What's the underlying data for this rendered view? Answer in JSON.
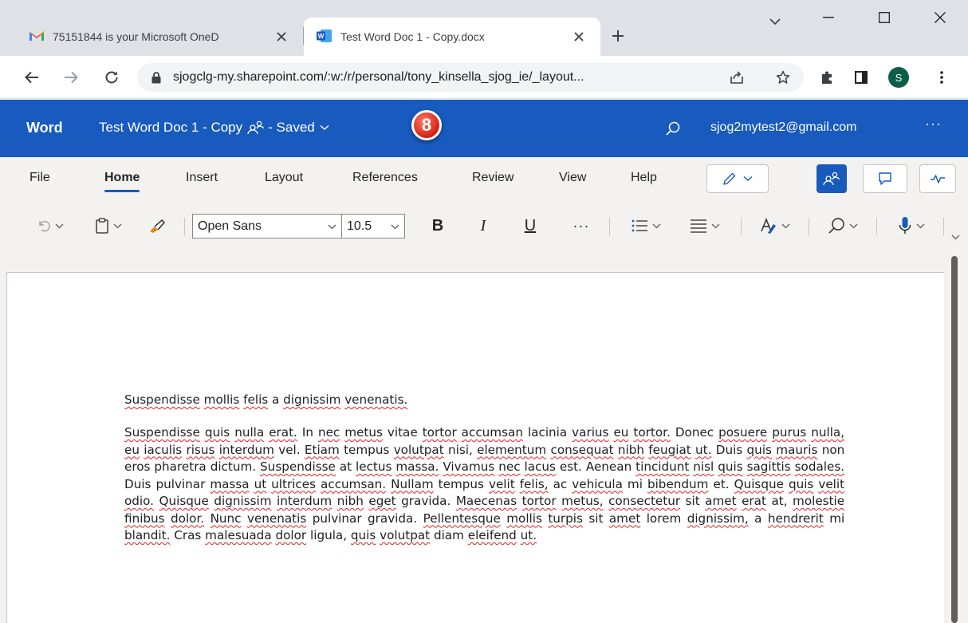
{
  "browser": {
    "tabs": [
      {
        "title": "75151844 is your Microsoft OneD",
        "favicon": "gmail-icon",
        "active": false
      },
      {
        "title": "Test Word Doc 1 - Copy.docx",
        "favicon": "word-icon",
        "active": true
      }
    ],
    "url": "sjogclg-my.sharepoint.com/:w:/r/personal/tony_kinsella_sjog_ie/_layout...",
    "profile_initial": "S",
    "colors": {
      "tabstrip": "#dee1e6",
      "profile": "#0b5e4a"
    }
  },
  "word": {
    "app_name": "Word",
    "doc_title": "Test Word Doc 1 - Copy",
    "save_status": "- Saved",
    "badge_number": "8",
    "account": "sjog2mytest2@gmail.com",
    "more": "···",
    "colors": {
      "header": "#185abd",
      "ribbon": "#f3f2f1",
      "badge": "#d4210f"
    }
  },
  "ribbon": {
    "tabs": [
      "File",
      "Home",
      "Insert",
      "Layout",
      "References",
      "Review",
      "View",
      "Help"
    ],
    "active_tab": "Home",
    "font_name": "Open Sans",
    "font_size": "10.5",
    "bold": "B",
    "italic": "I",
    "underline": "U",
    "more": "···"
  },
  "document": {
    "heading": "Suspendisse mollis felis a dignissim venenatis.",
    "body": "Suspendisse quis nulla erat. In nec metus vitae tortor accumsan lacinia varius eu tortor. Donec posuere purus nulla, eu iaculis risus interdum vel. Etiam tempus volutpat nisi, elementum consequat nibh feugiat ut. Duis quis mauris non eros pharetra dictum. Suspendisse at lectus massa. Vivamus nec lacus est. Aenean tincidunt nisl quis sagittis sodales. Duis pulvinar massa ut ultrices accumsan. Nullam tempus velit felis, ac vehicula mi bibendum et. Quisque quis velit odio. Quisque dignissim interdum nibh eget gravida. Maecenas tortor metus, consectetur sit amet erat at, molestie finibus dolor. Nunc venenatis pulvinar gravida. Pellentesque mollis turpis sit amet lorem dignissim, a hendrerit mi blandit. Cras malesuada dolor ligula, quis volutpat diam eleifend ut.",
    "spellcheck_words": [
      "Suspendisse",
      "mollis",
      "felis",
      "dignissim",
      "venenatis",
      "quis",
      "nulla",
      "erat",
      "nec",
      "metus",
      "tortor",
      "accumsan",
      "varius",
      "eu",
      "posuere",
      "purus",
      "iaculis",
      "risus",
      "interdum",
      "Etiam",
      "volutpat",
      "elementum",
      "consequat",
      "nibh",
      "feugiat",
      "ut",
      "mauris",
      "lectus",
      "massa",
      "Vivamus",
      "lacus",
      "tincidunt",
      "nisl",
      "sagittis",
      "sodales",
      "ultrices",
      "Nullam",
      "velit",
      "vehicula",
      "bibendum",
      "Quisque",
      "odio",
      "eget",
      "Maecenas",
      "consectetur",
      "amet",
      "molestie",
      "finibus",
      "dolor",
      "Nunc",
      "venenatis",
      "Pellentesque",
      "turpis",
      "hendrerit",
      "blandit",
      "malesuada",
      "ut",
      "eleifend"
    ]
  }
}
